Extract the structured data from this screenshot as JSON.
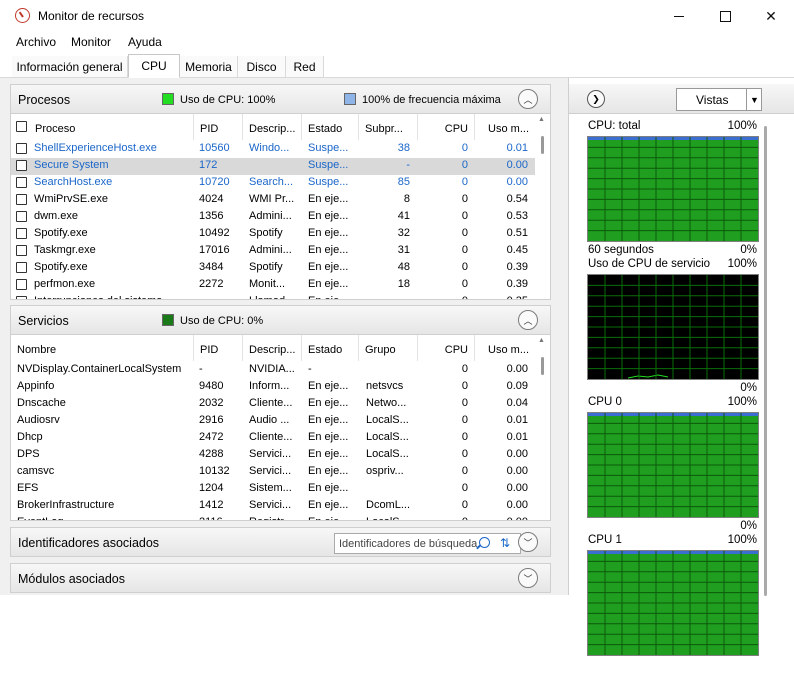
{
  "window": {
    "title": "Monitor de recursos"
  },
  "menu": [
    "Archivo",
    "Monitor",
    "Ayuda"
  ],
  "tabs": [
    {
      "label": "Información general",
      "active": false
    },
    {
      "label": "CPU",
      "active": true
    },
    {
      "label": "Memoria",
      "active": false
    },
    {
      "label": "Disco",
      "active": false
    },
    {
      "label": "Red",
      "active": false
    }
  ],
  "processes": {
    "title": "Procesos",
    "cpu_usage": "Uso de CPU: 100%",
    "max_freq": "100% de frecuencia máxima",
    "cpu_color": "#22dd22",
    "freq_color": "#8fb4e8",
    "columns": [
      "Proceso",
      "PID",
      "Descrip...",
      "Estado",
      "Subpr...",
      "CPU",
      "Uso m..."
    ],
    "rows": [
      {
        "name": "ShellExperienceHost.exe",
        "pid": "10560",
        "desc": "Windo...",
        "state": "Suspe...",
        "threads": "38",
        "cpu": "0",
        "avg": "0.01",
        "suspended": true,
        "selected": false
      },
      {
        "name": "Secure System",
        "pid": "172",
        "desc": "",
        "state": "Suspe...",
        "threads": "-",
        "cpu": "0",
        "avg": "0.00",
        "suspended": true,
        "selected": true
      },
      {
        "name": "SearchHost.exe",
        "pid": "10720",
        "desc": "Search...",
        "state": "Suspe...",
        "threads": "85",
        "cpu": "0",
        "avg": "0.00",
        "suspended": true,
        "selected": false
      },
      {
        "name": "WmiPrvSE.exe",
        "pid": "4024",
        "desc": "WMI Pr...",
        "state": "En eje...",
        "threads": "8",
        "cpu": "0",
        "avg": "0.54",
        "suspended": false,
        "selected": false
      },
      {
        "name": "dwm.exe",
        "pid": "1356",
        "desc": "Admini...",
        "state": "En eje...",
        "threads": "41",
        "cpu": "0",
        "avg": "0.53",
        "suspended": false,
        "selected": false
      },
      {
        "name": "Spotify.exe",
        "pid": "10492",
        "desc": "Spotify",
        "state": "En eje...",
        "threads": "32",
        "cpu": "0",
        "avg": "0.51",
        "suspended": false,
        "selected": false
      },
      {
        "name": "Taskmgr.exe",
        "pid": "17016",
        "desc": "Admini...",
        "state": "En eje...",
        "threads": "31",
        "cpu": "0",
        "avg": "0.45",
        "suspended": false,
        "selected": false
      },
      {
        "name": "Spotify.exe",
        "pid": "3484",
        "desc": "Spotify",
        "state": "En eje...",
        "threads": "48",
        "cpu": "0",
        "avg": "0.39",
        "suspended": false,
        "selected": false
      },
      {
        "name": "perfmon.exe",
        "pid": "2272",
        "desc": "Monit...",
        "state": "En eje...",
        "threads": "18",
        "cpu": "0",
        "avg": "0.39",
        "suspended": false,
        "selected": false
      },
      {
        "name": "Interrupciones del sistema",
        "pid": "-",
        "desc": "Llamad...",
        "state": "En eje...",
        "threads": "-",
        "cpu": "0",
        "avg": "0.35",
        "suspended": false,
        "selected": false
      }
    ]
  },
  "services": {
    "title": "Servicios",
    "cpu_usage": "Uso de CPU: 0%",
    "cpu_color": "#1a7a1a",
    "columns": [
      "Nombre",
      "PID",
      "Descrip...",
      "Estado",
      "Grupo",
      "CPU",
      "Uso m..."
    ],
    "rows": [
      {
        "name": "NVDisplay.ContainerLocalSystem",
        "pid": "-",
        "desc": "NVIDIA...",
        "state": "-",
        "group": "",
        "cpu": "0",
        "avg": "0.00"
      },
      {
        "name": "Appinfo",
        "pid": "9480",
        "desc": "Inform...",
        "state": "En eje...",
        "group": "netsvcs",
        "cpu": "0",
        "avg": "0.09"
      },
      {
        "name": "Dnscache",
        "pid": "2032",
        "desc": "Cliente...",
        "state": "En eje...",
        "group": "Netwo...",
        "cpu": "0",
        "avg": "0.04"
      },
      {
        "name": "Audiosrv",
        "pid": "2916",
        "desc": "Audio ...",
        "state": "En eje...",
        "group": "LocalS...",
        "cpu": "0",
        "avg": "0.01"
      },
      {
        "name": "Dhcp",
        "pid": "2472",
        "desc": "Cliente...",
        "state": "En eje...",
        "group": "LocalS...",
        "cpu": "0",
        "avg": "0.01"
      },
      {
        "name": "DPS",
        "pid": "4288",
        "desc": "Servici...",
        "state": "En eje...",
        "group": "LocalS...",
        "cpu": "0",
        "avg": "0.00"
      },
      {
        "name": "camsvc",
        "pid": "10132",
        "desc": "Servici...",
        "state": "En eje...",
        "group": "ospriv...",
        "cpu": "0",
        "avg": "0.00"
      },
      {
        "name": "EFS",
        "pid": "1204",
        "desc": "Sistem...",
        "state": "En eje...",
        "group": "",
        "cpu": "0",
        "avg": "0.00"
      },
      {
        "name": "BrokerInfrastructure",
        "pid": "1412",
        "desc": "Servici...",
        "state": "En eje...",
        "group": "DcomL...",
        "cpu": "0",
        "avg": "0.00"
      },
      {
        "name": "EventLog",
        "pid": "2116",
        "desc": "Registr...",
        "state": "En eje...",
        "group": "LocalS...",
        "cpu": "0",
        "avg": "0.00"
      }
    ]
  },
  "handles": {
    "title": "Identificadores asociados",
    "search_placeholder": "Identificadores de búsqueda"
  },
  "modules": {
    "title": "Módulos asociados"
  },
  "right_panel": {
    "views_label": "Vistas",
    "graphs": [
      {
        "title": "CPU: total",
        "max": "100%",
        "footer_left": "60 segundos",
        "footer_right": "0%",
        "load": "full"
      },
      {
        "title": "Uso de CPU de servicio",
        "max": "100%",
        "footer_left": "",
        "footer_right": "0%",
        "load": "low"
      },
      {
        "title": "CPU 0",
        "max": "100%",
        "footer_left": "",
        "footer_right": "0%",
        "load": "full"
      },
      {
        "title": "CPU 1",
        "max": "100%",
        "footer_left": "",
        "footer_right": "",
        "load": "full"
      }
    ]
  }
}
